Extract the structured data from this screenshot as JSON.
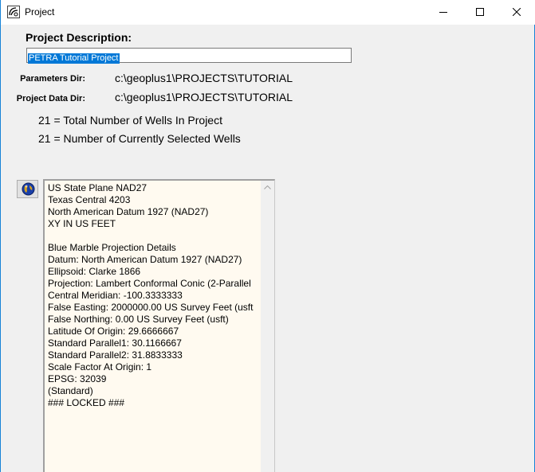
{
  "window": {
    "title": "Project",
    "icon": "project-app-icon",
    "controls": [
      "minimize-icon",
      "maximize-icon",
      "close-icon"
    ]
  },
  "project": {
    "description_label": "Project Description:",
    "description_value": "PETRA Tutorial Project",
    "parameters_dir_label": "Parameters Dir:",
    "parameters_dir_value": "c:\\geoplus1\\PROJECTS\\TUTORIAL",
    "data_dir_label": "Project Data Dir:",
    "data_dir_value": "c:\\geoplus1\\PROJECTS\\TUTORIAL",
    "total_wells_text": "21 = Total Number of Wells In Project",
    "selected_wells_text": "21 = Number of Currently Selected Wells"
  },
  "projection": {
    "button_icon": "globe-icon",
    "lines": [
      "US State Plane NAD27",
      "Texas Central 4203",
      "North American Datum 1927 (NAD27)",
      "XY IN US FEET",
      "",
      "Blue Marble Projection Details",
      "Datum: North American Datum 1927 (NAD27)",
      "Ellipsoid: Clarke 1866",
      "Projection: Lambert Conformal Conic (2-Parallel",
      "Central Meridian: -100.3333333",
      "False Easting: 2000000.00 US Survey Feet (usft",
      "False Northing: 0.00 US Survey Feet (usft)",
      "Latitude Of Origin: 29.6666667",
      "Standard Parallel1: 30.1166667",
      "Standard Parallel2: 31.8833333",
      "Scale Factor At Origin: 1",
      "EPSG: 32039",
      "(Standard)",
      "### LOCKED ###"
    ]
  },
  "colors": {
    "selection": "#0078d7",
    "window_border": "#1883d7",
    "text_area_bg": "#fffaf0"
  }
}
